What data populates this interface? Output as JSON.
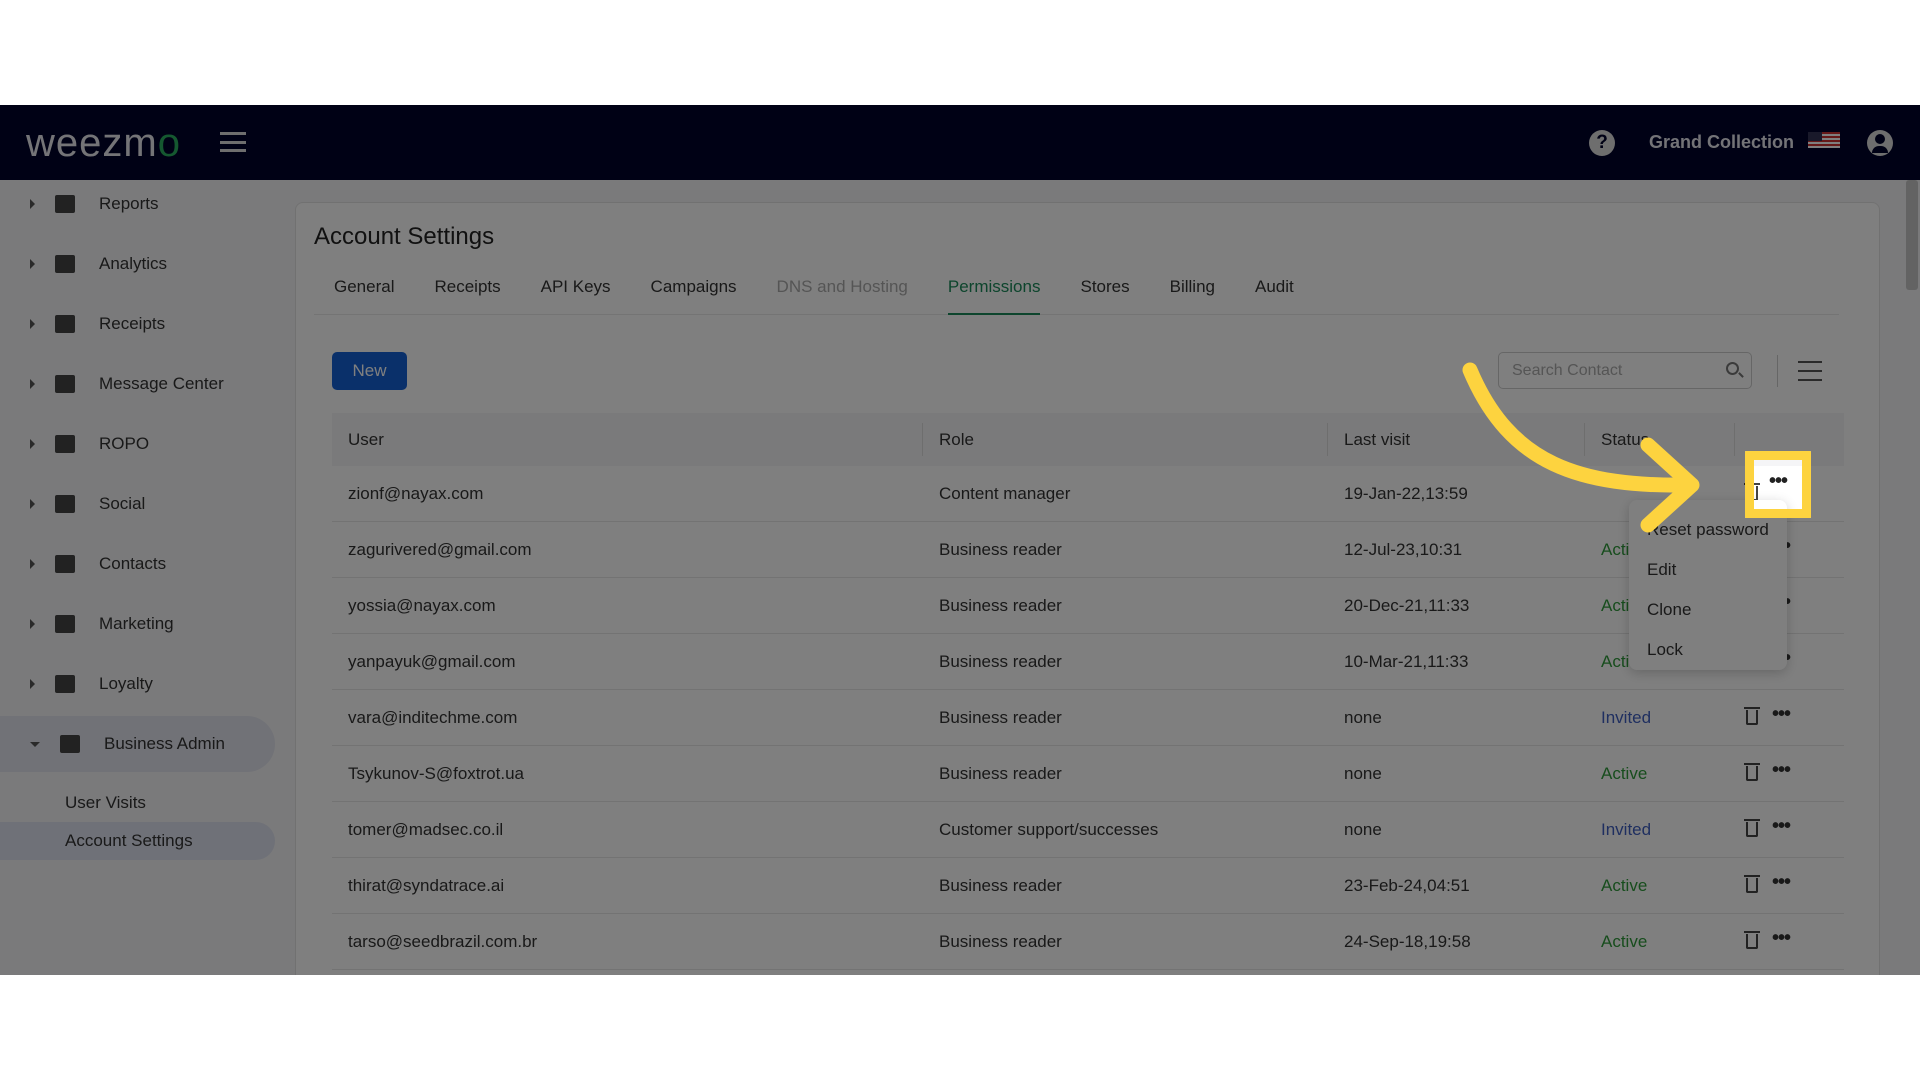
{
  "nav": {
    "logo": "weezmo",
    "store": "Grand Collection"
  },
  "sidebar": {
    "items": [
      {
        "label": "Reports",
        "icon": "dashboard-icon"
      },
      {
        "label": "Analytics",
        "icon": "chart-icon"
      },
      {
        "label": "Receipts",
        "icon": "receipt-icon"
      },
      {
        "label": "Message Center",
        "icon": "message-icon"
      },
      {
        "label": "ROPO",
        "icon": "infinity-icon"
      },
      {
        "label": "Social",
        "icon": "people-icon"
      },
      {
        "label": "Contacts",
        "icon": "contacts-icon"
      },
      {
        "label": "Marketing",
        "icon": "megaphone-icon"
      },
      {
        "label": "Loyalty",
        "icon": "tag-icon"
      },
      {
        "label": "Business Admin",
        "icon": "gear-icon"
      }
    ],
    "sub": [
      "User Visits",
      "Account Settings"
    ]
  },
  "page": {
    "title": "Account Settings",
    "tabs": [
      "General",
      "Receipts",
      "API Keys",
      "Campaigns",
      "DNS and Hosting",
      "Permissions",
      "Stores",
      "Billing",
      "Audit"
    ],
    "new_label": "New",
    "search_placeholder": "Search Contact"
  },
  "table": {
    "headers": [
      "User",
      "Role",
      "Last visit",
      "Status"
    ],
    "rows": [
      [
        "zionf@nayax.com",
        "Content manager",
        "19-Jan-22,13:59",
        ""
      ],
      [
        "zagurivered@gmail.com",
        "Business reader",
        "12-Jul-23,10:31",
        "Active"
      ],
      [
        "yossia@nayax.com",
        "Business reader",
        "20-Dec-21,11:33",
        "Active"
      ],
      [
        "yanpayuk@gmail.com",
        "Business reader",
        "10-Mar-21,11:33",
        "Active"
      ],
      [
        "vara@inditechme.com",
        "Business reader",
        "none",
        "Invited"
      ],
      [
        "Tsykunov-S@foxtrot.ua",
        "Business reader",
        "none",
        "Active"
      ],
      [
        "tomer@madsec.co.il",
        "Customer support/successes",
        "none",
        "Invited"
      ],
      [
        "thirat@syndatrace.ai",
        "Business reader",
        "23-Feb-24,04:51",
        "Active"
      ],
      [
        "tarso@seedbrazil.com.br",
        "Business reader",
        "24-Sep-18,19:58",
        "Active"
      ]
    ]
  },
  "menu": [
    "Reset password",
    "Edit",
    "Clone",
    "Lock"
  ],
  "colors": {
    "highlight": "#fdd33f",
    "active": "#2e9a3a",
    "invited": "#3f5fc0",
    "primary": "#1560d4"
  }
}
